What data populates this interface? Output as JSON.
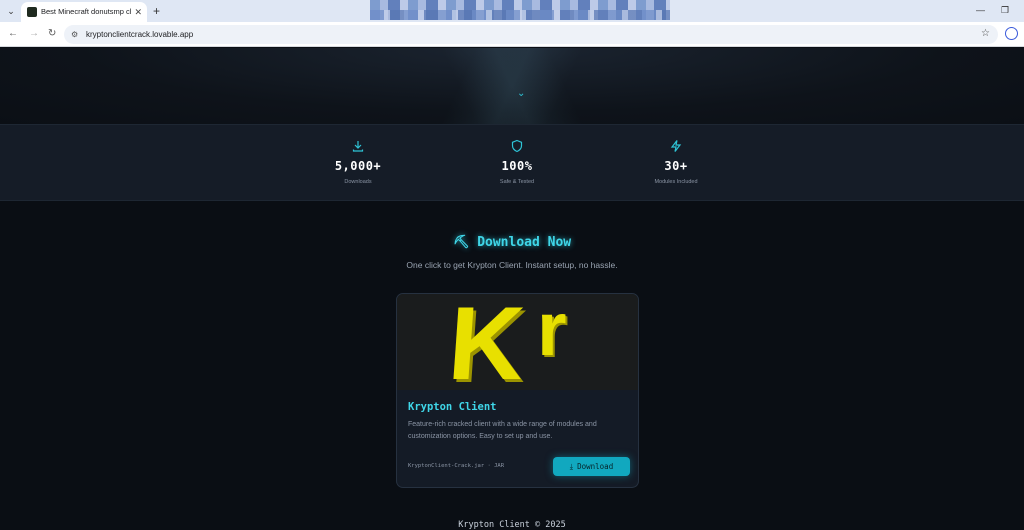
{
  "browser": {
    "tab_title": "Best Minecraft donutsmp chea",
    "tab_close": "✕",
    "new_tab": "+",
    "url": "kryptonclientcrack.lovable.app",
    "icons": [
      "tab-search-icon",
      "close-icon",
      "back-icon",
      "forward-icon",
      "reload-icon",
      "site-info-icon",
      "star-icon",
      "profile-icon",
      "minimize-icon",
      "restore-icon"
    ]
  },
  "hero": {
    "scroll_icon": "chevron-down-icon"
  },
  "stats": [
    {
      "icon": "download-icon",
      "value": "5,000+",
      "label": "Downloads"
    },
    {
      "icon": "shield-icon",
      "value": "100%",
      "label": "Safe & Tested"
    },
    {
      "icon": "lightning-icon",
      "value": "30+",
      "label": "Modules Included"
    }
  ],
  "download_section": {
    "title": "⛏ Download Now",
    "subtitle": "One click to get Krypton Client. Instant setup, no hassle."
  },
  "card": {
    "logo_k": "K",
    "logo_r": "r",
    "title": "Krypton Client",
    "description": "Feature-rich cracked client with a wide range of modules and customization options. Easy to set up and use.",
    "file": "KryptonClient-Crack.jar · JAR",
    "button_label": "Download"
  },
  "footer": {
    "text": "Krypton Client © 2025"
  },
  "colors": {
    "accent": "#2ec4d6",
    "button": "#11a8bf",
    "logo_yellow": "#e8e000",
    "background": "#0a0e14"
  }
}
